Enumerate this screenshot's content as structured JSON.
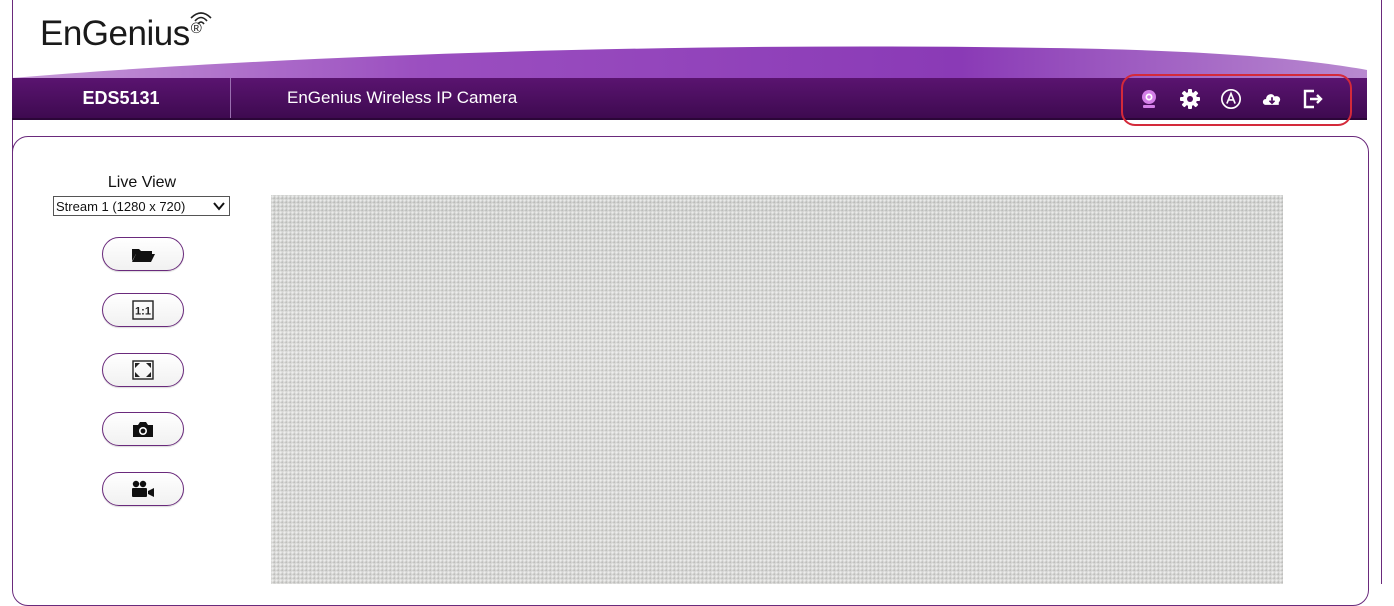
{
  "brand": {
    "logo_text": "EnGenius",
    "logo_mark": "®",
    "colors": {
      "header_purple": "#4b0a5e",
      "accent_purple": "#8e2fb5",
      "highlight_red": "#d42a3a"
    }
  },
  "header": {
    "model": "EDS5131",
    "product_name": "EnGenius Wireless IP Camera",
    "icons": [
      "live-view-icon",
      "settings-gear-icon",
      "a-circle-icon",
      "cloud-download-icon",
      "logout-icon"
    ]
  },
  "sidebar": {
    "live_view_label": "Live View",
    "stream_selected": "Stream 1 (1280 x 720)",
    "buttons": [
      {
        "name": "open-folder",
        "icon": "folder-icon"
      },
      {
        "name": "actual-size",
        "icon": "one-to-one-icon",
        "label": "1:1"
      },
      {
        "name": "fullscreen",
        "icon": "fullscreen-icon"
      },
      {
        "name": "snapshot",
        "icon": "camera-icon"
      },
      {
        "name": "record",
        "icon": "video-camera-icon"
      }
    ]
  }
}
